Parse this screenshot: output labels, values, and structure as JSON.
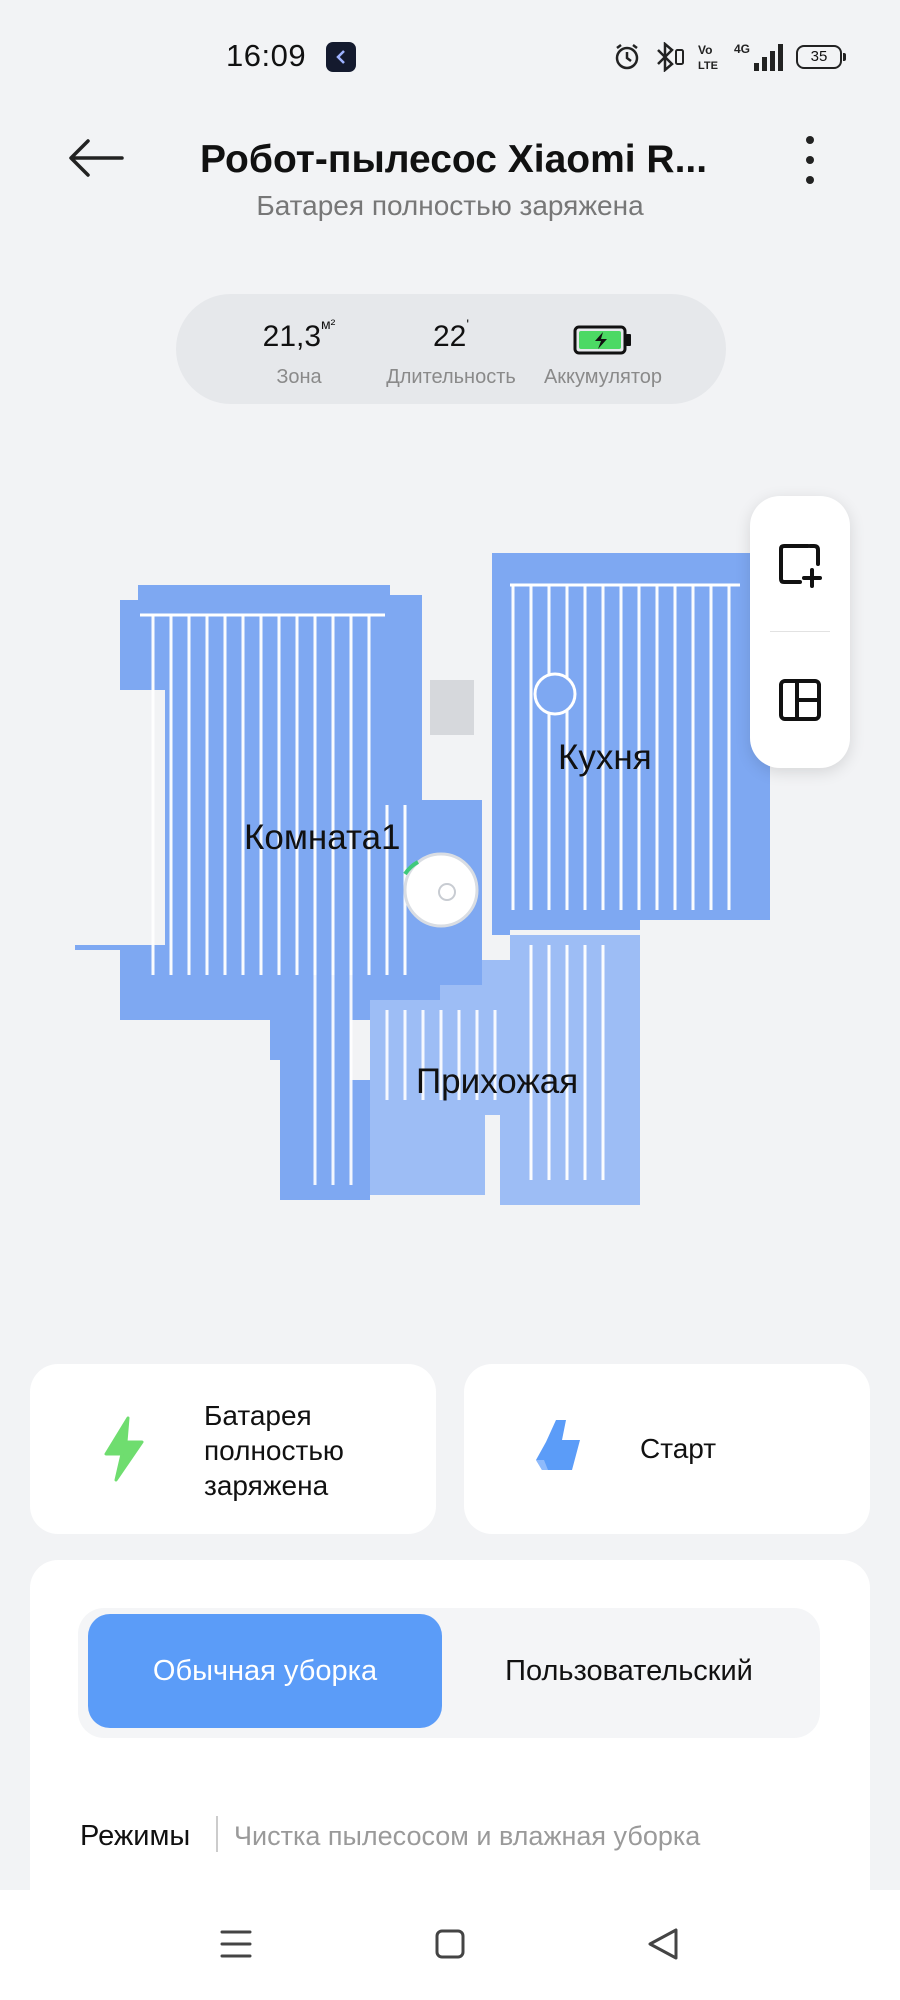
{
  "status_bar": {
    "time": "16:09",
    "network": "4G",
    "volte": "Vo LTE",
    "battery_level": "35",
    "icons": [
      "alarm-icon",
      "bluetooth-icon",
      "volte-icon",
      "signal-icon",
      "battery-icon"
    ]
  },
  "header": {
    "title": "Робот-пылесос Xiaomi R...",
    "subtitle": "Батарея полностью заряжена"
  },
  "stats": {
    "area_value": "21,3",
    "area_unit": "м²",
    "area_label": "Зона",
    "duration_value": "22",
    "duration_unit": "'",
    "duration_label": "Длительность",
    "battery_label": "Аккумулятор",
    "battery_fill": 1.0
  },
  "map": {
    "rooms": [
      "Комната1",
      "Кухня",
      "Прихожая"
    ]
  },
  "cards": {
    "battery_text": [
      "Батарея",
      "полностью",
      "заряжена"
    ],
    "start_label": "Старт"
  },
  "cleaning": {
    "mode_normal": "Обычная уборка",
    "mode_custom": "Пользовательский",
    "selected": "Обычная уборка",
    "modes_label": "Режимы",
    "modes_value": "Чистка пылесосом и влажная уборка"
  },
  "colors": {
    "accent": "#5b9cf8",
    "room_fill": "#7aa5f0",
    "battery_green": "#4cd964",
    "lightning_green": "#6fdd6f"
  }
}
